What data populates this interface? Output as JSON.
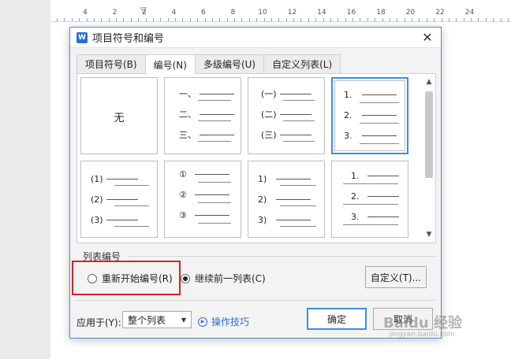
{
  "ruler": {
    "numbers": [
      "4",
      "2",
      "2",
      "4",
      "6",
      "8",
      "10",
      "12",
      "14",
      "16",
      "18",
      "20",
      "22",
      "24"
    ]
  },
  "dialog": {
    "app_icon": "W",
    "title": "项目符号和编号",
    "close_icon": "✕",
    "tabs": [
      {
        "label": "项目符号(B)",
        "active": false
      },
      {
        "label": "编号(N)",
        "active": true
      },
      {
        "label": "多级编号(U)",
        "active": false
      },
      {
        "label": "自定义列表(L)",
        "active": false
      }
    ],
    "numbering_styles": [
      {
        "id": "none",
        "label": "无"
      },
      {
        "id": "chinese-dun",
        "markers": [
          "一、",
          "二、",
          "三、"
        ]
      },
      {
        "id": "chinese-paren",
        "markers": [
          "(一)",
          "(二)",
          "(三)"
        ]
      },
      {
        "id": "arabic-dot",
        "markers": [
          "1.",
          "2.",
          "3."
        ],
        "selected": true
      },
      {
        "id": "arabic-paren",
        "markers": [
          "(1)",
          "(2)",
          "(3)"
        ]
      },
      {
        "id": "circled",
        "markers": [
          "①",
          "②",
          "③"
        ]
      },
      {
        "id": "arabic-half-paren",
        "markers": [
          "1)",
          "2)",
          "3)"
        ]
      },
      {
        "id": "arabic-dot-indent",
        "markers": [
          "1.",
          "2.",
          "3."
        ]
      }
    ],
    "list_numbering": {
      "section_label": "列表编号",
      "restart_label": "重新开始编号(R)",
      "restart_checked": false,
      "continue_label": "继续前一列表(C)",
      "continue_checked": true,
      "customize_label": "自定义(T)..."
    },
    "footer": {
      "apply_to_label": "应用于(Y):",
      "apply_to_value": "整个列表",
      "tips_label": "操作技巧",
      "ok_label": "确定",
      "cancel_label": "取消"
    }
  },
  "watermark": {
    "brand": "Baidu 经验",
    "url": "jingyan.baidu.com"
  },
  "colors": {
    "accent": "#3a8ee6",
    "highlight": "#e02020",
    "link": "#2b6fd1"
  }
}
